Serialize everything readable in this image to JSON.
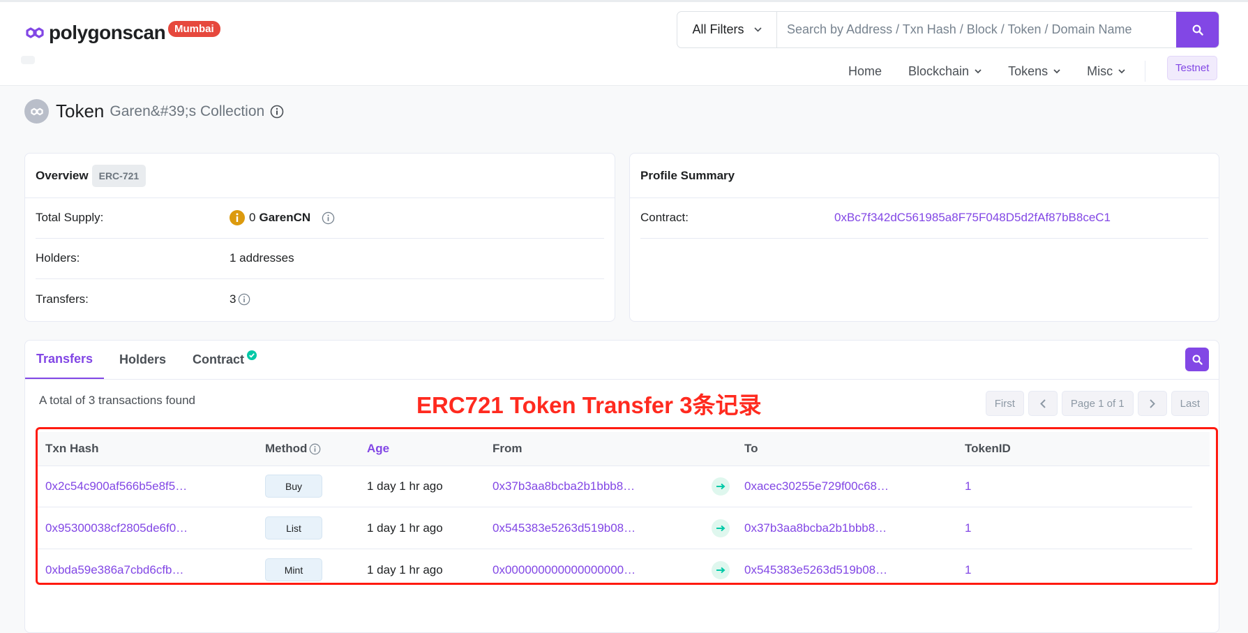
{
  "header": {
    "logo_text": "polygonscan",
    "network_badge": "Mumbai",
    "filter_label": "All Filters",
    "search_placeholder": "Search by Address / Txn Hash / Block / Token / Domain Name",
    "nav": [
      {
        "label": "Home"
      },
      {
        "label": "Blockchain"
      },
      {
        "label": "Tokens"
      },
      {
        "label": "Misc"
      }
    ],
    "testnet_label": "Testnet"
  },
  "page": {
    "title": "Token",
    "subtitle": "Garen&#39;s Collection"
  },
  "overview": {
    "title": "Overview",
    "badge": "ERC-721",
    "rows": [
      {
        "label": "Total Supply:",
        "value": "0",
        "symbol": "GarenCN"
      },
      {
        "label": "Holders:",
        "value": "1 addresses"
      },
      {
        "label": "Transfers:",
        "value": "3"
      }
    ]
  },
  "profile": {
    "title": "Profile Summary",
    "contract_label": "Contract:",
    "contract_value": "0xBc7f342dC561985a8F75F048D5d2fAf87bB8ceC1"
  },
  "transfers": {
    "tabs": [
      {
        "label": "Transfers"
      },
      {
        "label": "Holders"
      },
      {
        "label": "Contract"
      }
    ],
    "total_text": "A total of 3 transactions found",
    "annotation": "ERC721 Token Transfer 3条记录",
    "pager": {
      "first": "First",
      "page": "Page 1 of 1",
      "last": "Last"
    },
    "columns": [
      "Txn Hash",
      "Method",
      "Age",
      "From",
      "To",
      "TokenID"
    ],
    "rows": [
      {
        "hash": "0x2c54c900af566b5e8f5…",
        "method": "Buy",
        "age": "1 day 1 hr ago",
        "from": "0x37b3aa8bcba2b1bbb8…",
        "to": "0xacec30255e729f00c68…",
        "token_id": "1"
      },
      {
        "hash": "0x95300038cf2805de6f0…",
        "method": "List",
        "age": "1 day 1 hr ago",
        "from": "0x545383e5263d519b08…",
        "to": "0x37b3aa8bcba2b1bbb8…",
        "token_id": "1"
      },
      {
        "hash": "0xbda59e386a7cbd6cfb…",
        "method": "Mint",
        "age": "1 day 1 hr ago",
        "from": "0x000000000000000000…",
        "to": "0x545383e5263d519b08…",
        "token_id": "1"
      }
    ]
  },
  "colors": {
    "accent": "#8247e5",
    "badge_red": "#e6483d",
    "annotation_red": "#ff2a1f",
    "success_green": "#00c9a7"
  }
}
